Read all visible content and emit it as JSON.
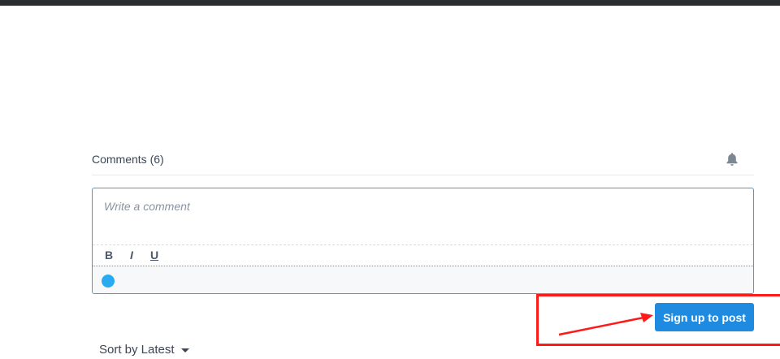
{
  "comments": {
    "title": "Comments (6)",
    "notifications_icon": "bell-icon"
  },
  "editor": {
    "placeholder": "Write a comment",
    "toolbar": {
      "bold": "B",
      "italic": "I",
      "underline": "U"
    }
  },
  "actions": {
    "signup_label": "Sign up to post"
  },
  "sort": {
    "label": "Sort by Latest"
  },
  "colors": {
    "accent": "#1e8be0",
    "annotation": "#ff1a1a",
    "avatar": "#2aaaf0"
  }
}
